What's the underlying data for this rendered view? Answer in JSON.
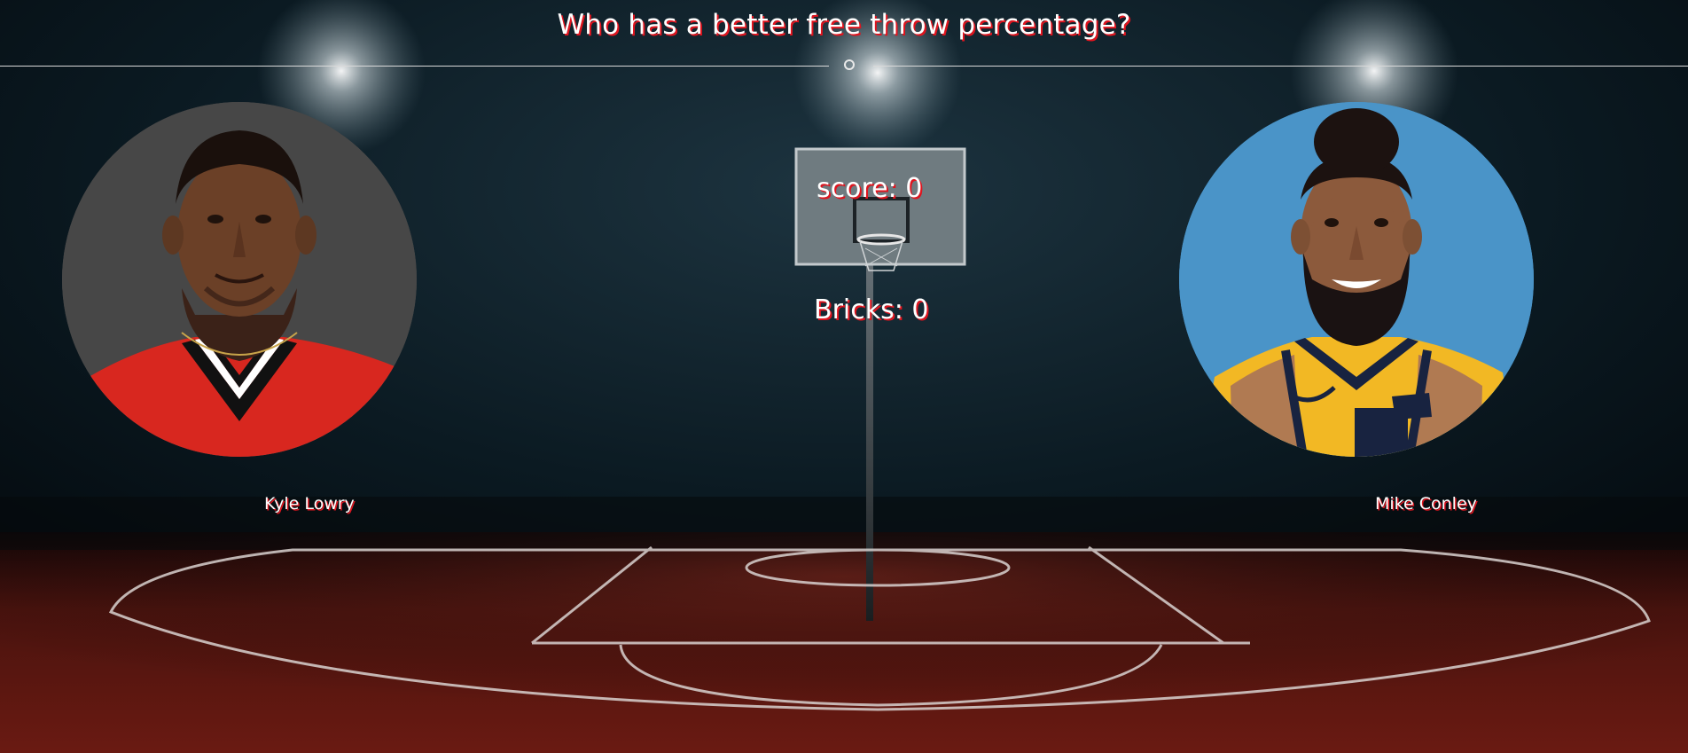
{
  "game": {
    "question": "Who has a better free throw percentage?",
    "score_text": "score: 0",
    "bricks_text": "Bricks: 0"
  },
  "players": [
    {
      "name": "Kyle Lowry",
      "jersey_color": "#d8271f",
      "photo_bg": "#474747"
    },
    {
      "name": "Mike Conley",
      "jersey_color": "#f2b824",
      "photo_bg": "#4a94c8"
    }
  ],
  "colors": {
    "text": "#ffffff",
    "text_shadow": "#e0141e",
    "court": "#5a1510",
    "background": "#0a1820"
  }
}
